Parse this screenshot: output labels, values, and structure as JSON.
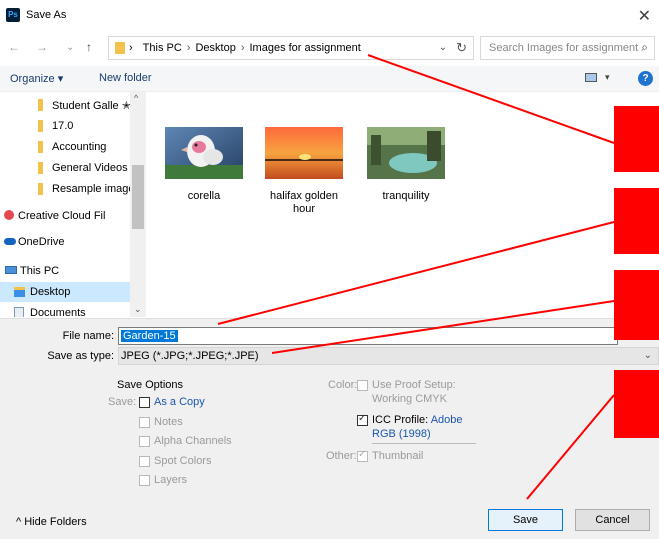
{
  "window": {
    "title": "Save As",
    "app_badge": "Ps",
    "close_glyph": "✕"
  },
  "nav": {
    "back_glyph": "←",
    "forward_glyph": "→",
    "recent_glyph": "⌄",
    "up_glyph": "↑",
    "breadcrumb": [
      "This PC",
      "Desktop",
      "Images for assignment"
    ],
    "separator": "›",
    "dropdown_glyph": "⌄",
    "refresh_glyph": "↻",
    "search_placeholder": "Search Images for assignment",
    "search_icon_glyph": "⌕"
  },
  "toolbar": {
    "organize": "Organize ▾",
    "new_folder": "New folder",
    "view_drop": "▾",
    "help": "?"
  },
  "sidebar": {
    "items": [
      {
        "label": "Student Galle ✭",
        "icon": "folder-icon"
      },
      {
        "label": "17.0",
        "icon": "folder-icon"
      },
      {
        "label": "Accounting",
        "icon": "folder-icon"
      },
      {
        "label": "General Videos",
        "icon": "folder-icon"
      },
      {
        "label": "Resample image",
        "icon": "folder-icon"
      },
      {
        "label": "Creative Cloud Fil",
        "icon": "creative-cloud-icon"
      },
      {
        "label": "OneDrive",
        "icon": "cloud-icon"
      },
      {
        "label": "This PC",
        "icon": "computer-icon"
      },
      {
        "label": "Desktop",
        "icon": "desktop-folder-icon",
        "selected": true
      },
      {
        "label": "Documents",
        "icon": "documents-icon"
      }
    ],
    "scroll_up": "^",
    "scroll_down": "⌄"
  },
  "files": [
    {
      "name": "corella",
      "kind": "parrot photo"
    },
    {
      "name": "halifax golden hour",
      "kind": "sunset photo"
    },
    {
      "name": "tranquility",
      "kind": "lake photo"
    }
  ],
  "form": {
    "file_name_label": "File name:",
    "file_name_value": "Garden-15",
    "save_as_type_label": "Save as type:",
    "save_as_type_value": "JPEG (*.JPG;*.JPEG;*.JPE)",
    "dropdown_glyph": "⌄"
  },
  "save_options": {
    "heading": "Save Options",
    "save_label": "Save:",
    "as_a_copy": "As a Copy",
    "notes": "Notes",
    "alpha_channels": "Alpha Channels",
    "spot_colors": "Spot Colors",
    "layers": "Layers",
    "color_label": "Color:",
    "use_proof_line1": "Use Proof Setup:",
    "use_proof_line2": "Working CMYK",
    "icc_line1": "ICC Profile:",
    "icc_line1b": "Adobe",
    "icc_line2": "RGB (1998)",
    "other_label": "Other:",
    "thumbnail": "Thumbnail"
  },
  "buttons": {
    "hide_folders": "^  Hide Folders",
    "save": "Save",
    "cancel": "Cancel"
  },
  "colors": {
    "selection_blue": "#0078d7",
    "annotation_red": "#ff0000",
    "folder_yellow": "#f3c24d"
  }
}
